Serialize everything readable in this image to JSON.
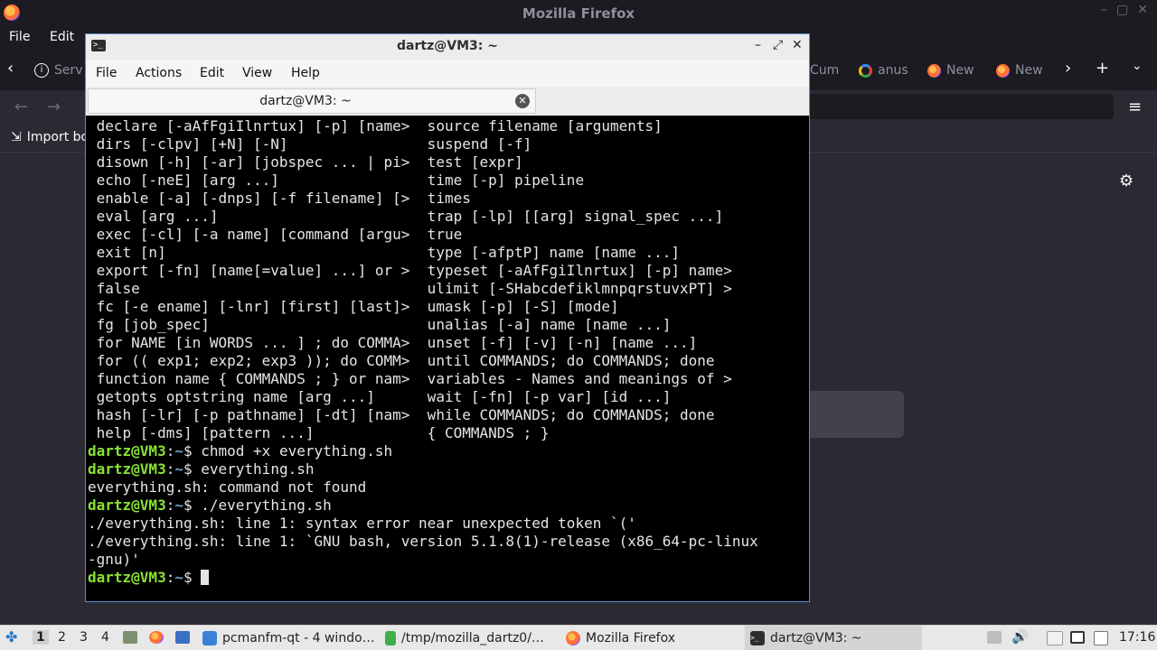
{
  "firefox": {
    "window_title": "Mozilla Firefox",
    "menu": {
      "file": "File",
      "edit": "Edit"
    },
    "tabs": [
      {
        "label": "Serv"
      },
      {
        "label": "Cum"
      },
      {
        "label": "anus"
      },
      {
        "label": "New"
      },
      {
        "label": "New"
      }
    ],
    "bookmarks": {
      "import_label": "Import bo"
    }
  },
  "terminal": {
    "window_title": "dartz@VM3: ~",
    "menu": {
      "file": "File",
      "actions": "Actions",
      "edit": "Edit",
      "view": "View",
      "help": "Help"
    },
    "tab_label": "dartz@VM3: ~",
    "help_lines": [
      " declare [-aAfFgiIlnrtux] [-p] [name>  source filename [arguments]",
      " dirs [-clpv] [+N] [-N]                suspend [-f]",
      " disown [-h] [-ar] [jobspec ... | pi>  test [expr]",
      " echo [-neE] [arg ...]                 time [-p] pipeline",
      " enable [-a] [-dnps] [-f filename] [>  times",
      " eval [arg ...]                        trap [-lp] [[arg] signal_spec ...]",
      " exec [-cl] [-a name] [command [argu>  true",
      " exit [n]                              type [-afptP] name [name ...]",
      " export [-fn] [name[=value] ...] or >  typeset [-aAfFgiIlnrtux] [-p] name>",
      " false                                 ulimit [-SHabcdefiklmnpqrstuvxPT] >",
      " fc [-e ename] [-lnr] [first] [last]>  umask [-p] [-S] [mode]",
      " fg [job_spec]                         unalias [-a] name [name ...]",
      " for NAME [in WORDS ... ] ; do COMMA>  unset [-f] [-v] [-n] [name ...]",
      " for (( exp1; exp2; exp3 )); do COMM>  until COMMANDS; do COMMANDS; done",
      " function name { COMMANDS ; } or nam>  variables - Names and meanings of >",
      " getopts optstring name [arg ...]      wait [-fn] [-p var] [id ...]",
      " hash [-lr] [-p pathname] [-dt] [nam>  while COMMANDS; do COMMANDS; done",
      " help [-dms] [pattern ...]             { COMMANDS ; }"
    ],
    "prompt_user": "dartz@VM3",
    "prompt_sep": ":",
    "prompt_path": "~",
    "prompt_dollar": "$ ",
    "cmd1": "chmod +x everything.sh",
    "cmd2": "everything.sh",
    "out2": "everything.sh: command not found",
    "cmd3": "./everything.sh",
    "out3": [
      "./everything.sh: line 1: syntax error near unexpected token `('",
      "./everything.sh: line 1: `GNU bash, version 5.1.8(1)-release (x86_64-pc-linux",
      "-gnu)'"
    ]
  },
  "panel": {
    "workspaces": [
      "1",
      "2",
      "3",
      "4"
    ],
    "tasks": [
      {
        "label": "pcmanfm-qt - 4 windo…",
        "icon": "folder-icon"
      },
      {
        "label": "/tmp/mozilla_dartz0/…",
        "icon": "file-icon"
      },
      {
        "label": "Mozilla Firefox",
        "icon": "firefox-icon"
      },
      {
        "label": "dartz@VM3: ~",
        "icon": "terminal-icon"
      }
    ],
    "clock": "17:16"
  }
}
